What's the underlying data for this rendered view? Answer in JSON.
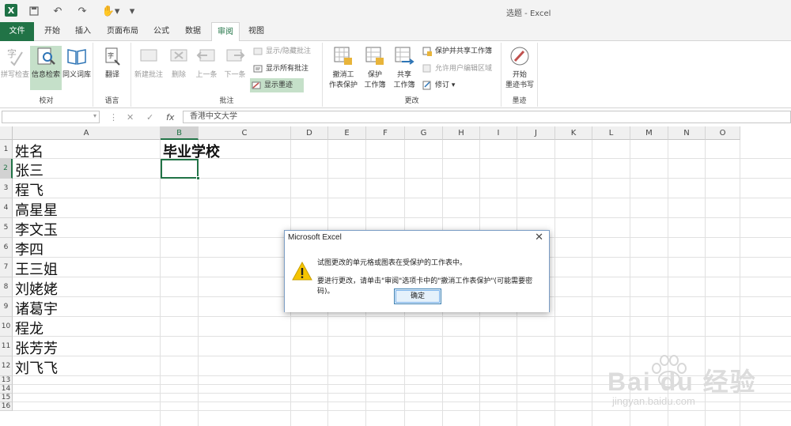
{
  "window": {
    "title": "选题 - Excel"
  },
  "tabs": [
    {
      "label": "文件"
    },
    {
      "label": "开始"
    },
    {
      "label": "插入"
    },
    {
      "label": "页面布局"
    },
    {
      "label": "公式"
    },
    {
      "label": "数据"
    },
    {
      "label": "审阅"
    },
    {
      "label": "视图"
    }
  ],
  "ribbon": {
    "proofing": {
      "spelling": "拼写检查",
      "research": "信息检索",
      "thesaurus": "同义词库",
      "label": "校对"
    },
    "language": {
      "translate": "翻译",
      "label": "语言"
    },
    "comments": {
      "new": "新建批注",
      "delete": "删除",
      "prev": "上一条",
      "next": "下一条",
      "show_hide": "显示/隐藏批注",
      "show_all": "显示所有批注",
      "show_ink": "显示墨迹",
      "label": "批注"
    },
    "changes": {
      "unprotect_sheet": "撤消工",
      "unprotect_sheet2": "作表保护",
      "protect_workbook": "保护",
      "protect_workbook2": "工作簿",
      "share_workbook": "共享",
      "share_workbook2": "工作簿",
      "protect_share": "保护并共享工作簿",
      "allow_edit": "允许用户编辑区域",
      "track": "修订",
      "label": "更改"
    },
    "ink": {
      "start": "开始",
      "start2": "墨迹书写",
      "label": "墨迹"
    }
  },
  "formula_bar": {
    "name_box": "",
    "fx": "fx",
    "content": "香港中文大学"
  },
  "columns": [
    "A",
    "B",
    "C",
    "D",
    "E",
    "F",
    "G",
    "H",
    "I",
    "J",
    "K",
    "L",
    "M",
    "N",
    "O"
  ],
  "rows": [
    "1",
    "2",
    "3",
    "4",
    "5",
    "6",
    "7",
    "8",
    "9",
    "10",
    "11",
    "12",
    "13",
    "14",
    "15",
    "16"
  ],
  "cells": {
    "A1": "姓名",
    "B1": "毕业学校",
    "names": [
      "张三",
      "程飞",
      "高星星",
      "李文玉",
      "李四",
      "王三姐",
      "刘姥姥",
      "诸葛宇",
      "程龙",
      "张芳芳",
      "刘飞飞"
    ]
  },
  "dialog": {
    "title": "Microsoft Excel",
    "message1": "试图更改的单元格或图表在受保护的工作表中。",
    "message2": "要进行更改，请单击\"审阅\"选项卡中的\"撤消工作表保护\"(可能需要密码)。",
    "ok": "确定"
  },
  "watermark": {
    "brand": "Bai du 经验",
    "url": "jingyan.baidu.com"
  },
  "colors": {
    "accent": "#217346",
    "highlight": "#c5e0c9"
  }
}
